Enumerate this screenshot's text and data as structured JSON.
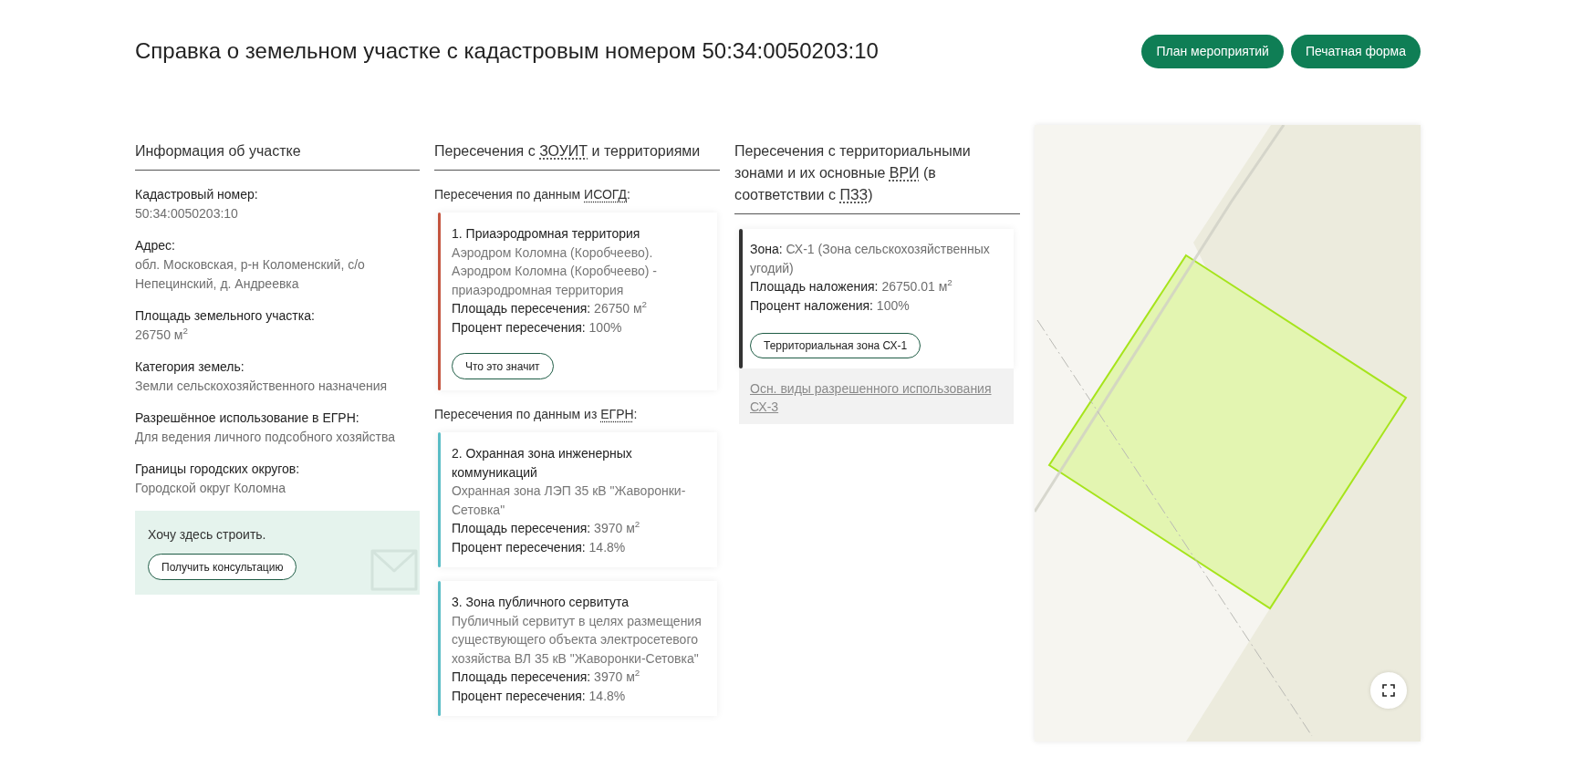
{
  "header": {
    "title": "Справка о земельном участке с кадастровым номером 50:34:0050203:10",
    "buttons": [
      {
        "label": "План мероприятий"
      },
      {
        "label": "Печатная форма"
      }
    ]
  },
  "plot_info": {
    "heading": "Информация об участке",
    "fields": [
      {
        "label": "Кадастровый номер:",
        "value": "50:34:0050203:10"
      },
      {
        "label": "Адрес:",
        "value": "обл. Московская, р-н Коломенский, с/о Непецинский, д. Андреевка"
      },
      {
        "label": "Площадь земельного участка:",
        "value": "26750 м$^{2}$"
      },
      {
        "label": "Категория земель:",
        "value": "Земли сельскохозяйственного назначения"
      },
      {
        "label": "Разрешённое использование в ЕГРН:",
        "value": "Для ведения личного подсобного хозяйства"
      },
      {
        "label": "Границы городских округов:",
        "value": "Городской округ Коломна"
      }
    ],
    "cta": {
      "text": "Хочу здесь строить.",
      "button": "Получить консультацию"
    }
  },
  "zouit": {
    "heading": [
      {
        "kind": "text",
        "text": "Пересечения с "
      },
      {
        "kind": "abbr",
        "text": "ЗОУИТ"
      },
      {
        "kind": "text",
        "text": " и территориями"
      }
    ],
    "groups": [
      {
        "title": [
          {
            "kind": "text",
            "text": "Пересечения по данным "
          },
          {
            "kind": "abbr",
            "text": "ИСОГД"
          },
          {
            "kind": "text",
            "text": ":"
          }
        ],
        "cards": [
          {
            "color": "#c4553f",
            "title": "1. Приаэродромная территория",
            "description": "Аэродром Коломна (Коробчеево). Аэродром Коломна (Коробчеево) - приаэродромная территория",
            "fields": [
              {
                "label": "Площадь пересечения:",
                "value": "26750 м$^{2}$"
              },
              {
                "label": "Процент пересечения:",
                "value": "100%"
              }
            ],
            "button": "Что это значит"
          }
        ]
      },
      {
        "title": [
          {
            "kind": "text",
            "text": "Пересечения по данным из "
          },
          {
            "kind": "abbr",
            "text": "ЕГРН"
          },
          {
            "kind": "text",
            "text": ":"
          }
        ],
        "cards": [
          {
            "color": "#5bbdc6",
            "title": "2. Охранная зона инженерных коммуникаций",
            "description": "Охранная зона ЛЭП 35 кВ \"Жаворонки-Сетовка\"",
            "fields": [
              {
                "label": "Площадь пересечения:",
                "value": "3970 м$^{2}$"
              },
              {
                "label": "Процент пересечения:",
                "value": "14.8%"
              }
            ]
          },
          {
            "color": "#5bbdc6",
            "title": "3. Зона публичного сервитута",
            "description": "Публичный сервитут в целях размещения существующего объекта электросетевого хозяйства ВЛ 35 кВ \"Жаворонки-Сетовка\"",
            "fields": [
              {
                "label": "Площадь пересечения:",
                "value": "3970 м$^{2}$"
              },
              {
                "label": "Процент пересечения:",
                "value": "14.8%"
              }
            ]
          }
        ]
      }
    ]
  },
  "zones": {
    "heading": [
      {
        "kind": "text",
        "text": "Пересечения с территориальными зонами и их основные "
      },
      {
        "kind": "abbr",
        "text": "ВРИ"
      },
      {
        "kind": "text",
        "text": " (в соответствии с "
      },
      {
        "kind": "abbr",
        "text": "ПЗЗ"
      },
      {
        "kind": "text",
        "text": ")"
      }
    ],
    "zone_card": {
      "fields": [
        {
          "label": "Зона:",
          "value": "СХ-1 (Зона сельскохозяйственных угодий)"
        },
        {
          "label": "Площадь наложения:",
          "value": "26750.01 м$^{2}$"
        },
        {
          "label": "Процент наложения:",
          "value": "100%"
        }
      ],
      "button": "Территориальная зона СХ-1"
    },
    "permitted_uses_link": "Осн. виды разрешенного использования СХ-3"
  }
}
